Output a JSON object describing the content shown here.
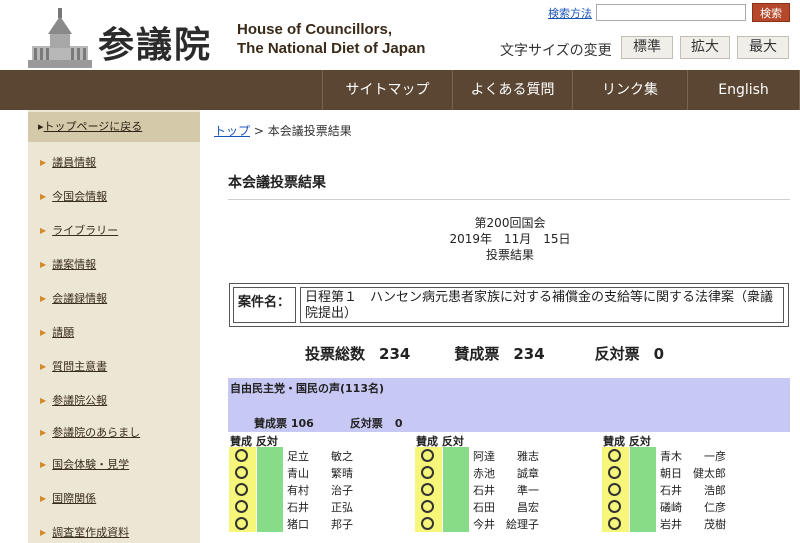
{
  "header": {
    "logo_kanji": "参議院",
    "logo_en_line1": "House of Councillors,",
    "logo_en_line2": "The National Diet of Japan",
    "search_link": "検索方法",
    "search_button": "検索",
    "font_size_label": "文字サイズの変更",
    "font_sizes": [
      "標準",
      "拡大",
      "最大"
    ]
  },
  "nav": {
    "items": [
      "サイトマップ",
      "よくある質問",
      "リンク集",
      "English"
    ]
  },
  "sidebar": {
    "top": "トップページに戻る",
    "items": [
      "議員情報",
      "今国会情報",
      "ライブラリー",
      "議案情報",
      "会議録情報",
      "請願",
      "質問主意書",
      "参議院公報",
      "参議院のあらまし",
      "国会体験・見学",
      "国際関係",
      "調査室作成資料"
    ]
  },
  "breadcrumb": {
    "home": "トップ",
    "sep": " > ",
    "current": "本会議投票結果"
  },
  "main": {
    "title": "本会議投票結果",
    "session": "第200回国会",
    "date": "2019年　11月　15日",
    "result_label": "投票結果",
    "case_label": "案件名：",
    "case_text": "日程第１　ハンセン病元患者家族に対する補償金の支給等に関する法律案（衆議院提出）",
    "totals": {
      "total_label": "投票総数",
      "total_value": "234",
      "yes_label": "賛成票",
      "yes_value": "234",
      "no_label": "反対票",
      "no_value": "0"
    },
    "party": {
      "name": "自由民主党・国民の声(113名)",
      "yes_label": "賛成票",
      "yes_value": "106",
      "no_label": "反対票",
      "no_value": "0"
    },
    "column_header": "賛成 反対",
    "columns": [
      [
        "足立　　敏之",
        "青山　　繁晴",
        "有村　　治子",
        "石井　　正弘",
        "猪口　　邦子"
      ],
      [
        "阿達　　雅志",
        "赤池　　誠章",
        "石井　　準一",
        "石田　　昌宏",
        "今井　絵理子"
      ],
      [
        "青木　　一彦",
        "朝日　健太郎",
        "石井　　浩郎",
        "礒崎　　仁彦",
        "岩井　　茂樹"
      ]
    ]
  },
  "colors": {
    "nav_bg": "#5a4632",
    "sidebar_bg": "#ece6d5",
    "party_bg": "#c8c8f4",
    "yes_cell": "#f6f67a",
    "no_cell": "#88dc88",
    "search_button": "#b5482b"
  }
}
